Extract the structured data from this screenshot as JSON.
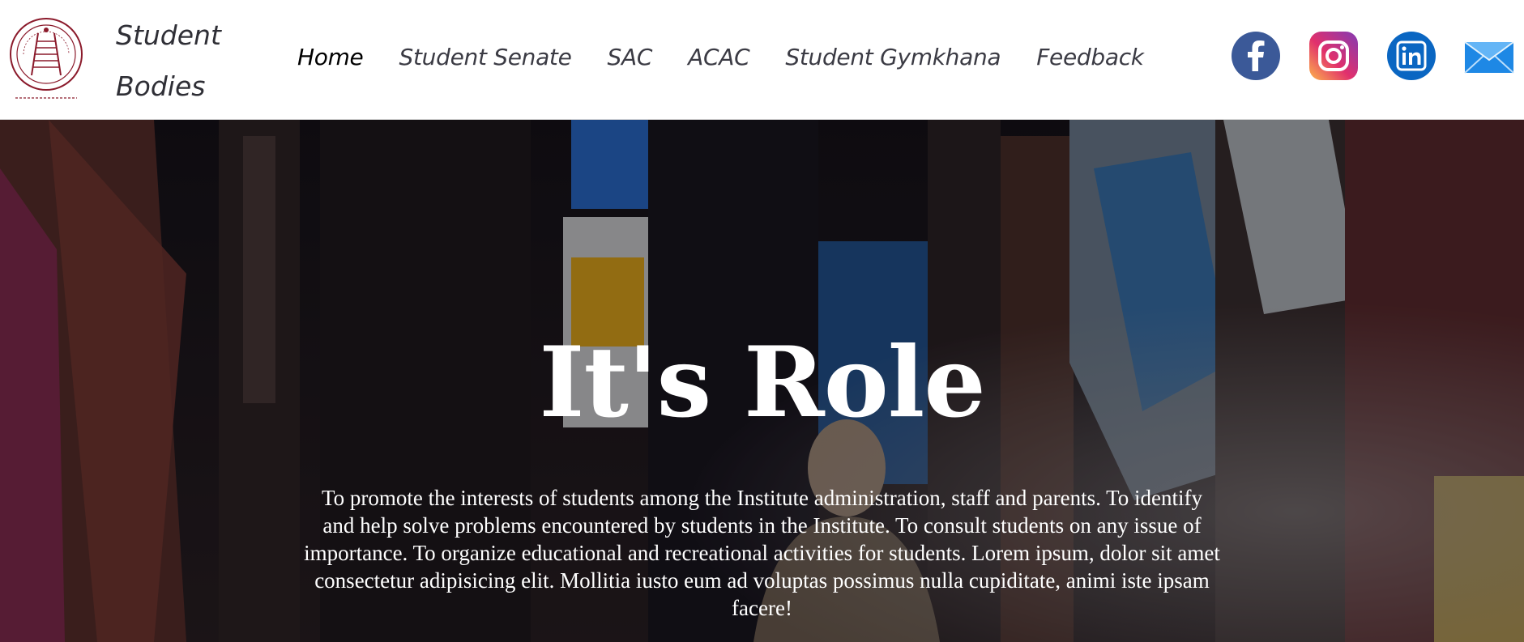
{
  "header": {
    "brand_line1": "Student",
    "brand_line2": "Bodies",
    "logo_icon": "institute-seal-icon",
    "nav": [
      {
        "label": "Home",
        "active": true
      },
      {
        "label": "Student Senate",
        "active": false
      },
      {
        "label": "SAC",
        "active": false
      },
      {
        "label": "ACAC",
        "active": false
      },
      {
        "label": "Student Gymkhana",
        "active": false
      },
      {
        "label": "Feedback",
        "active": false
      }
    ],
    "socials": [
      {
        "icon": "facebook-icon",
        "color": "#3b5998"
      },
      {
        "icon": "instagram-icon",
        "color": "#d6249f"
      },
      {
        "icon": "linkedin-icon",
        "color": "#0a66c2"
      },
      {
        "icon": "mail-icon",
        "color": "#1e88e5"
      }
    ]
  },
  "hero": {
    "title": "It's Role",
    "body": "To promote the interests of students among the Institute administration, staff and parents. To identify and help solve problems encountered by students in the Institute. To consult students on any issue of importance. To organize educational and recreational activities for students. Lorem ipsum, dolor sit amet consectetur adipisicing elit. Mollitia iusto eum ad voluptas possimus nulla cupiditate, animi iste ipsam facere!"
  },
  "colors": {
    "brand_seal": "#8b1a2b",
    "nav_text": "#3b3b44",
    "nav_active": "#000000"
  }
}
